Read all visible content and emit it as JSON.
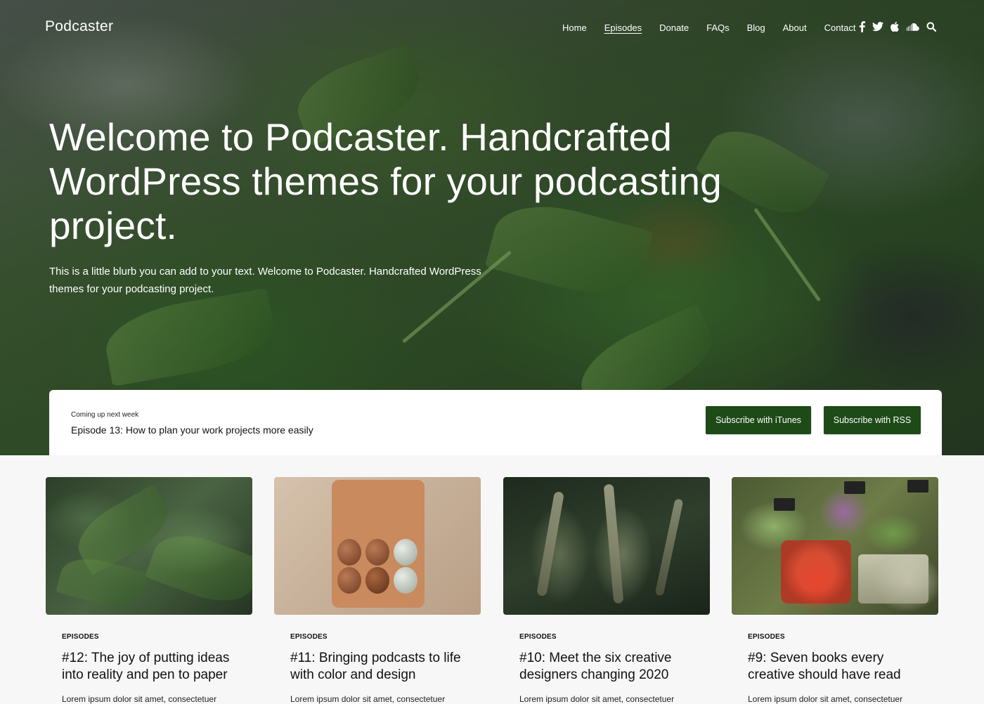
{
  "site": {
    "brand": "Podcaster"
  },
  "nav": {
    "items": [
      {
        "label": "Home"
      },
      {
        "label": "Episodes"
      },
      {
        "label": "Donate"
      },
      {
        "label": "FAQs"
      },
      {
        "label": "Blog"
      },
      {
        "label": "About"
      },
      {
        "label": "Contact"
      }
    ],
    "active": "Episodes",
    "social_icons": [
      "facebook-icon",
      "twitter-icon",
      "apple-icon",
      "soundcloud-icon",
      "search-icon"
    ]
  },
  "hero": {
    "headline": "Welcome to Podcaster. Handcrafted WordPress themes for your podcasting project.",
    "blurb": "This is a little blurb you can add to your text. Welcome to Podcaster. Handcrafted WordPress themes for your podcasting project."
  },
  "upcoming": {
    "label": "Coming up next week",
    "title": "Episode 13: How to plan your work projects more easily",
    "itunes_button": "Subscribe with iTunes",
    "rss_button": "Subscribe with RSS",
    "button_color": "#1d4a17"
  },
  "episodes": [
    {
      "category": "EPISODES",
      "title": "#12: The joy of putting ideas into reality and pen to paper",
      "excerpt": "Lorem ipsum dolor sit amet, consectetuer"
    },
    {
      "category": "EPISODES",
      "title": "#11: Bringing podcasts to life with color and design",
      "excerpt": "Lorem ipsum dolor sit amet, consectetuer"
    },
    {
      "category": "EPISODES",
      "title": "#10: Meet the six creative designers changing 2020",
      "excerpt": "Lorem ipsum dolor sit amet, consectetuer"
    },
    {
      "category": "EPISODES",
      "title": "#9: Seven books every creative should have read",
      "excerpt": "Lorem ipsum dolor sit amet, consectetuer"
    }
  ]
}
